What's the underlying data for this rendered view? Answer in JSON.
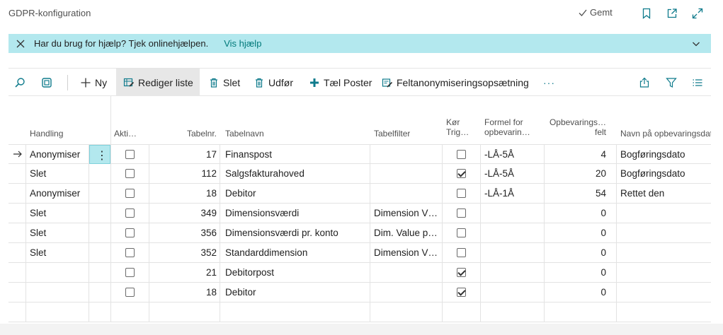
{
  "page": {
    "title": "GDPR-konfiguration",
    "saved": "Gemt"
  },
  "banner": {
    "message": "Har du brug for hjælp? Tjek onlinehjælpen.",
    "link": "Vis hjælp"
  },
  "toolbar": {
    "new": "Ny",
    "edit_list": "Rediger liste",
    "delete": "Slet",
    "run": "Udfør",
    "count": "Tæl Poster",
    "field_setup": "Feltanonymiseringsopsætning",
    "more": "···"
  },
  "columns": {
    "action": "Handling",
    "active": "Akti…",
    "table_no": "Tabelnr.",
    "table_name": "Tabelnavn",
    "table_filter": "Tabelfilter",
    "run_trigger_1": "Kør",
    "run_trigger_2": "Trig…",
    "formula_1": "Formel for",
    "formula_2": "opbevarin…",
    "retention_1": "Opbevarings…",
    "retention_2": "felt",
    "date_name": "Navn på opbevaringsdato"
  },
  "rows": [
    {
      "action": "Anonymiser",
      "active": false,
      "table_no": "17",
      "table_name": "Finanspost",
      "filter": "",
      "trigger": false,
      "formula": "-LÅ-5Å",
      "field": "4",
      "date_name": "Bogføringsdato",
      "current": true
    },
    {
      "action": "Slet",
      "active": false,
      "table_no": "112",
      "table_name": "Salgsfakturahoved",
      "filter": "",
      "trigger": true,
      "formula": "-LÅ-5Å",
      "field": "20",
      "date_name": "Bogføringsdato"
    },
    {
      "action": "Anonymiser",
      "active": false,
      "table_no": "18",
      "table_name": "Debitor",
      "filter": "",
      "trigger": false,
      "formula": "-LÅ-1Å",
      "field": "54",
      "date_name": "Rettet den"
    },
    {
      "action": "Slet",
      "active": false,
      "table_no": "349",
      "table_name": "Dimensionsværdi",
      "filter": "Dimension V…",
      "trigger": false,
      "formula": "",
      "field": "0",
      "date_name": ""
    },
    {
      "action": "Slet",
      "active": false,
      "table_no": "356",
      "table_name": "Dimensionsværdi pr. konto",
      "filter": "Dim. Value p…",
      "trigger": false,
      "formula": "",
      "field": "0",
      "date_name": ""
    },
    {
      "action": "Slet",
      "active": false,
      "table_no": "352",
      "table_name": "Standarddimension",
      "filter": "Dimension V…",
      "trigger": false,
      "formula": "",
      "field": "0",
      "date_name": ""
    },
    {
      "action": "",
      "active": false,
      "table_no": "21",
      "table_name": "Debitorpost",
      "filter": "",
      "trigger": true,
      "formula": "",
      "field": "0",
      "date_name": ""
    },
    {
      "action": "",
      "active": false,
      "table_no": "18",
      "table_name": "Debitor",
      "filter": "",
      "trigger": true,
      "formula": "",
      "field": "0",
      "date_name": ""
    },
    {
      "action": "",
      "active": null,
      "table_no": "",
      "table_name": "",
      "filter": "",
      "trigger": null,
      "formula": "",
      "field": "",
      "date_name": ""
    }
  ],
  "colors": {
    "accent": "#00797a",
    "banner": "#b3e8ee",
    "icon": "#0f7b8c"
  }
}
